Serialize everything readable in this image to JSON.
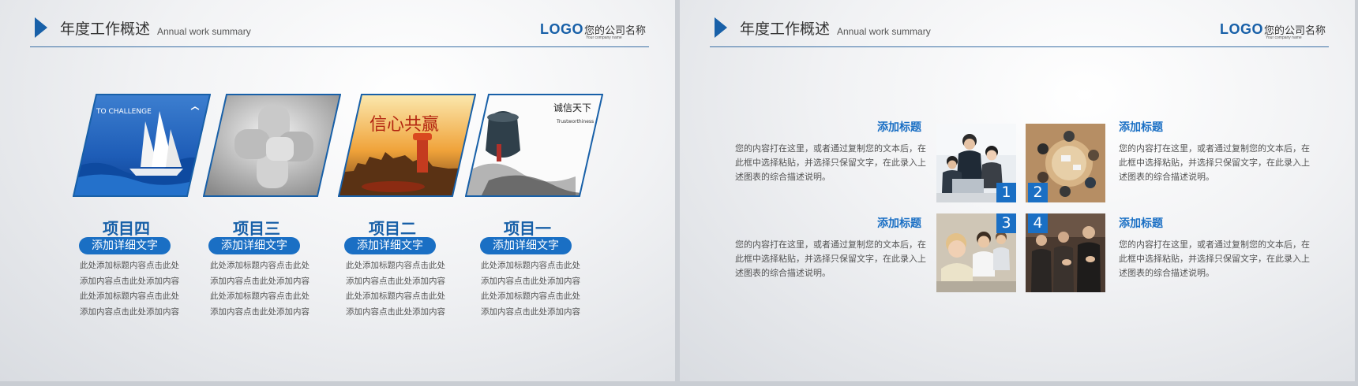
{
  "header": {
    "title": "年度工作概述",
    "subtitle": "Annual work summary",
    "logo": "LOGO",
    "company": "您的公司名称",
    "company_en": "Your company name"
  },
  "left": {
    "panel_texts": {
      "p1_line1": "TO CHALLENGE",
      "p3_calligraphy": "信心共赢",
      "p4_calligraphy": "诚信天下",
      "p4_en": "Trustworthiness"
    },
    "projects": [
      {
        "title": "项目四",
        "button": "添加详细文字",
        "desc": "此处添加标题内容点击此处添加内容点击此处添加内容此处添加标题内容点击此处添加内容点击此处添加内容"
      },
      {
        "title": "项目三",
        "button": "添加详细文字",
        "desc": "此处添加标题内容点击此处添加内容点击此处添加内容此处添加标题内容点击此处添加内容点击此处添加内容"
      },
      {
        "title": "项目二",
        "button": "添加详细文字",
        "desc": "此处添加标题内容点击此处添加内容点击此处添加内容此处添加标题内容点击此处添加内容点击此处添加内容"
      },
      {
        "title": "项目一",
        "button": "添加详细文字",
        "desc": "此处添加标题内容点击此处添加内容点击此处添加内容此处添加标题内容点击此处添加内容点击此处添加内容"
      }
    ]
  },
  "right": {
    "items": [
      {
        "title": "添加标题",
        "body": "您的内容打在这里，或者通过复制您的文本后，在此框中选择粘贴，并选择只保留文字，在此录入上述图表的综合描述说明。",
        "number": "1"
      },
      {
        "title": "添加标题",
        "body": "您的内容打在这里，或者通过复制您的文本后，在此框中选择粘贴，并选择只保留文字，在此录入上述图表的综合描述说明。",
        "number": "2"
      },
      {
        "title": "添加标题",
        "body": "您的内容打在这里，或者通过复制您的文本后，在此框中选择粘贴，并选择只保留文字，在此录入上述图表的综合描述说明。",
        "number": "3"
      },
      {
        "title": "添加标题",
        "body": "您的内容打在这里，或者通过复制您的文本后，在此框中选择粘贴，并选择只保留文字，在此录入上述图表的综合描述说明。",
        "number": "4"
      }
    ]
  },
  "colors": {
    "accent": "#1a6fc4",
    "title_blue": "#1860a8"
  }
}
